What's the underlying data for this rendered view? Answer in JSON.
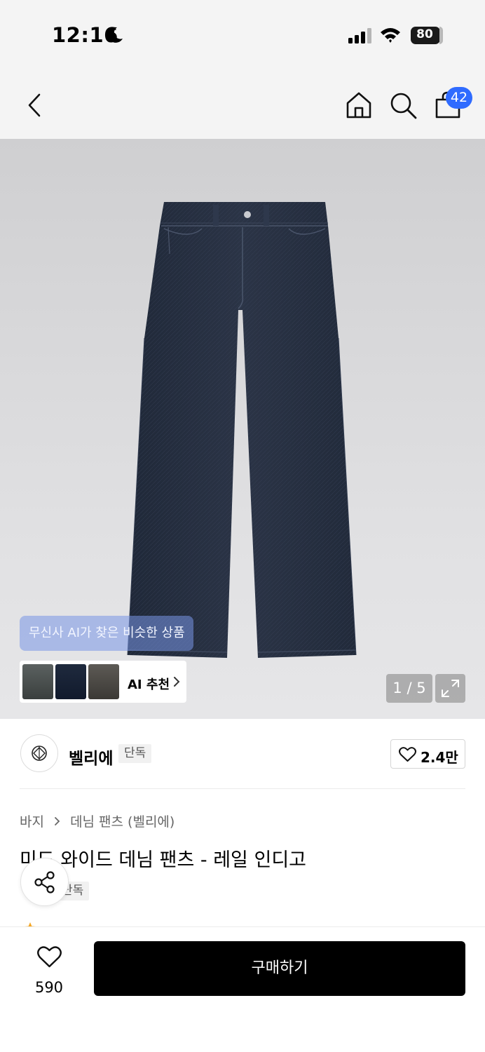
{
  "status_bar": {
    "time": "12:16",
    "battery": "80"
  },
  "nav": {
    "cart_count": "42"
  },
  "gallery": {
    "ai_tooltip": "무신사 AI가 찾은 비슷한 상품",
    "ai_rec_label": "AI 추천",
    "page_counter": "1 / 5"
  },
  "brand": {
    "name": "벨리에",
    "tag": "단독",
    "like_count": "2.4만"
  },
  "product": {
    "breadcrumb": [
      "바지",
      "데님 팬츠 (벨리에)"
    ],
    "title": "미드 와이드 데님 팬츠 - 레일 인디고",
    "tag": "단독"
  },
  "bottom": {
    "wish_count": "590",
    "buy_label": "구매하기"
  },
  "colors": {
    "badge": "#2f6bff",
    "buy_button": "#000000",
    "denim": "#252e3f"
  }
}
